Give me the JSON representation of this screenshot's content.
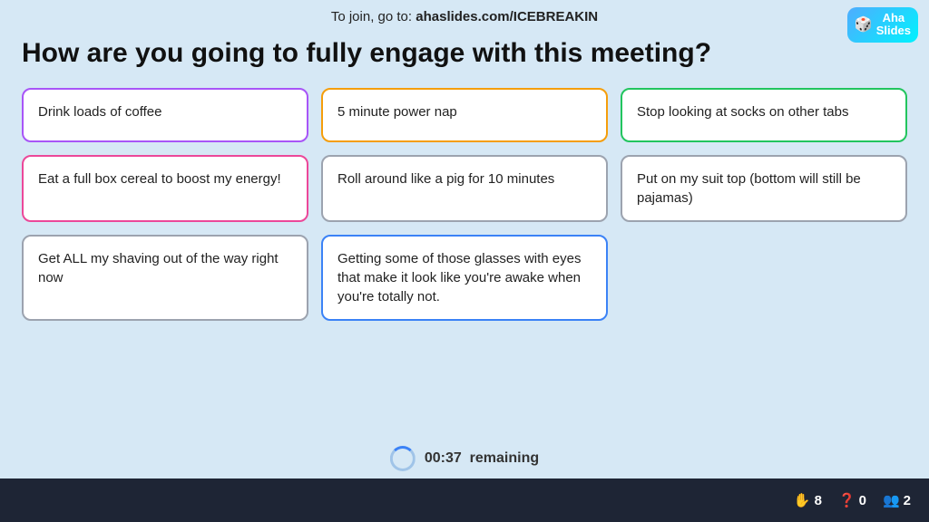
{
  "topbar": {
    "join_text": "To join, go to: ",
    "join_url": "ahaslides.com/ICEBREAKIN"
  },
  "logo": {
    "text_line1": "Aha",
    "text_line2": "Slides",
    "icon": "🎲"
  },
  "question": {
    "text": "How are you going to fully engage with this meeting?"
  },
  "cards": [
    {
      "text": "Drink loads of coffee",
      "border": "border-purple"
    },
    {
      "text": "5 minute power nap",
      "border": "border-yellow"
    },
    {
      "text": "Stop looking at socks on other tabs",
      "border": "border-green"
    },
    {
      "text": "Eat a full box cereal to boost my energy!",
      "border": "border-pink"
    },
    {
      "text": "Roll around like a pig for 10 minutes",
      "border": "border-gray"
    },
    {
      "text": "Put on my suit top (bottom will still be pajamas)",
      "border": "border-gray"
    },
    {
      "text": "Get ALL my shaving out of the way right now",
      "border": "border-gray"
    },
    {
      "text": "Getting some of those glasses with eyes that make it look like you're awake when you're totally not.",
      "border": "border-blue"
    }
  ],
  "timer": {
    "time": "00:37",
    "label": "remaining"
  },
  "stats": {
    "hands": "8",
    "questions": "0",
    "users": "2"
  }
}
